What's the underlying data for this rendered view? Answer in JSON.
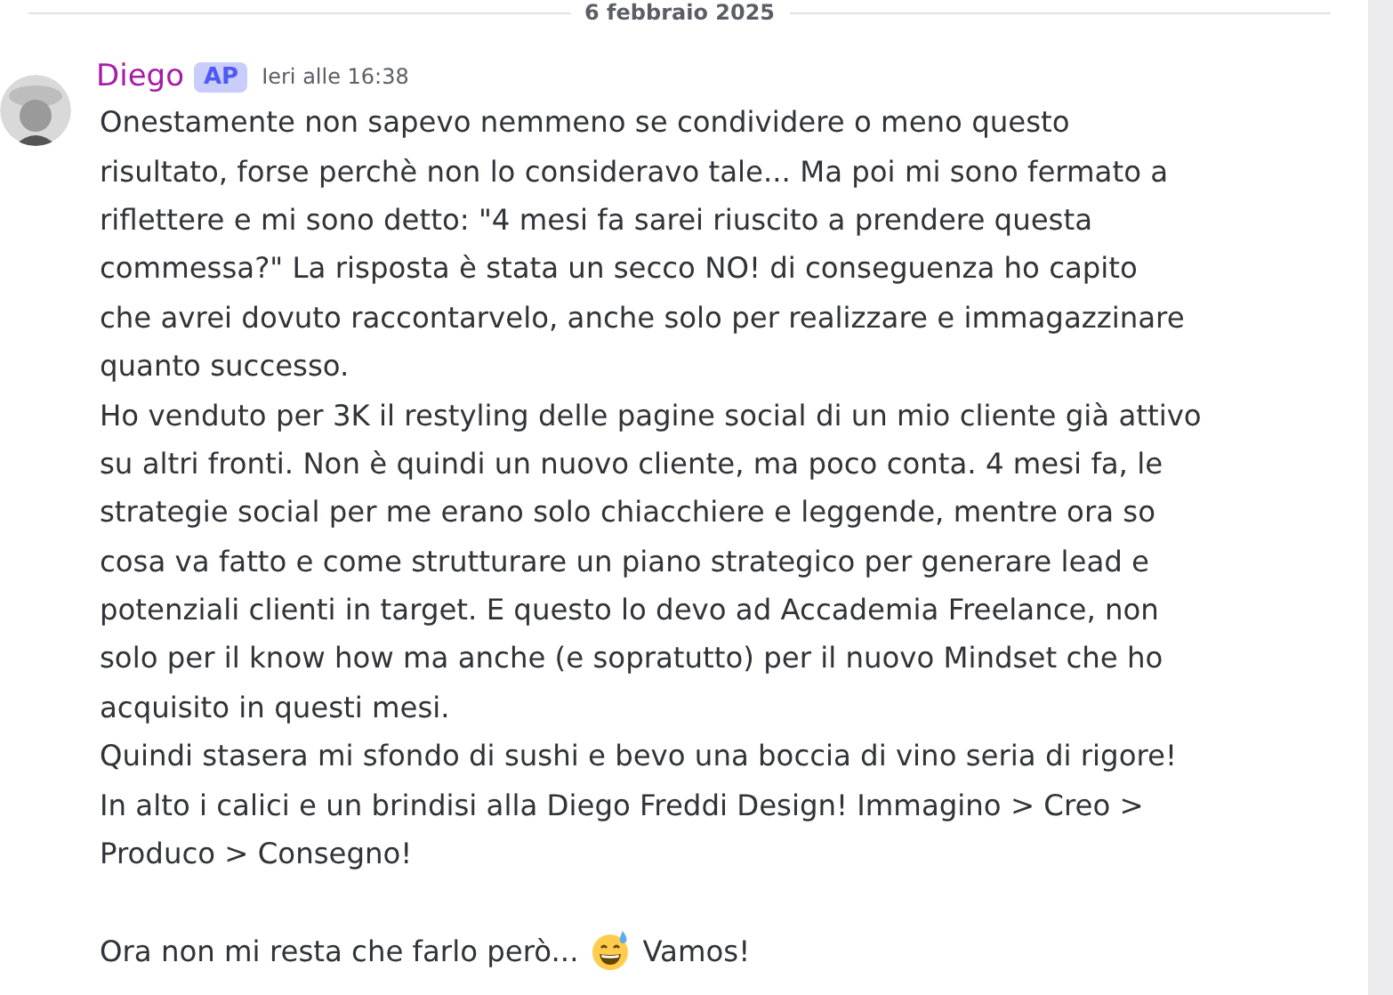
{
  "date_divider": "6 febbraio 2025",
  "message": {
    "author": "Diego",
    "badge": "AP",
    "timestamp": "Ieri alle 16:38",
    "paragraphs": [
      {
        "lines": [
          {
            "text": "Onestamente non sapevo nemmeno se condividere o meno questo"
          },
          {
            "text": "risultato, forse perchè non lo consideravo tale... Ma poi mi sono fermato a"
          },
          {
            "text": "riflettere e mi sono detto: \"4 mesi fa sarei riuscito a prendere questa"
          },
          {
            "text": "commessa?\" La risposta è stata un secco NO! di conseguenza ho capito"
          },
          {
            "text": "che avrei dovuto raccontarvelo, anche solo per realizzare e immagazzinare"
          },
          {
            "text": "quanto successo."
          },
          {
            "text": "Ho venduto per 3K il restyling delle pagine social di un mio cliente già attivo"
          },
          {
            "text": "su altri fronti. Non è quindi un nuovo cliente, ma poco conta. 4 mesi fa, le"
          },
          {
            "text": "strategie social per me erano solo chiacchiere e leggende, mentre ora so"
          },
          {
            "text": "cosa va fatto e come strutturare un piano strategico per generare lead e"
          },
          {
            "text": "potenziali clienti in target. E questo lo devo ad Accademia Freelance, non"
          },
          {
            "text": "solo per il know how ma anche (e sopratutto) per il nuovo Mindset che ho"
          },
          {
            "text": "acquisito in questi mesi."
          },
          {
            "text": "Quindi stasera mi sfondo di sushi e bevo una boccia di vino seria di rigore!"
          },
          {
            "text": "In alto i calici e un brindisi alla Diego Freddi Design! Immagino > Creo >"
          },
          {
            "text": "Produco > Consegno!"
          }
        ]
      },
      {
        "lines": [
          {
            "segments": [
              {
                "kind": "text",
                "text": "Ora non mi resta che farlo però..."
              },
              {
                "kind": "emoji"
              },
              {
                "kind": "text",
                "text": "Vamos!"
              }
            ]
          }
        ]
      }
    ]
  }
}
